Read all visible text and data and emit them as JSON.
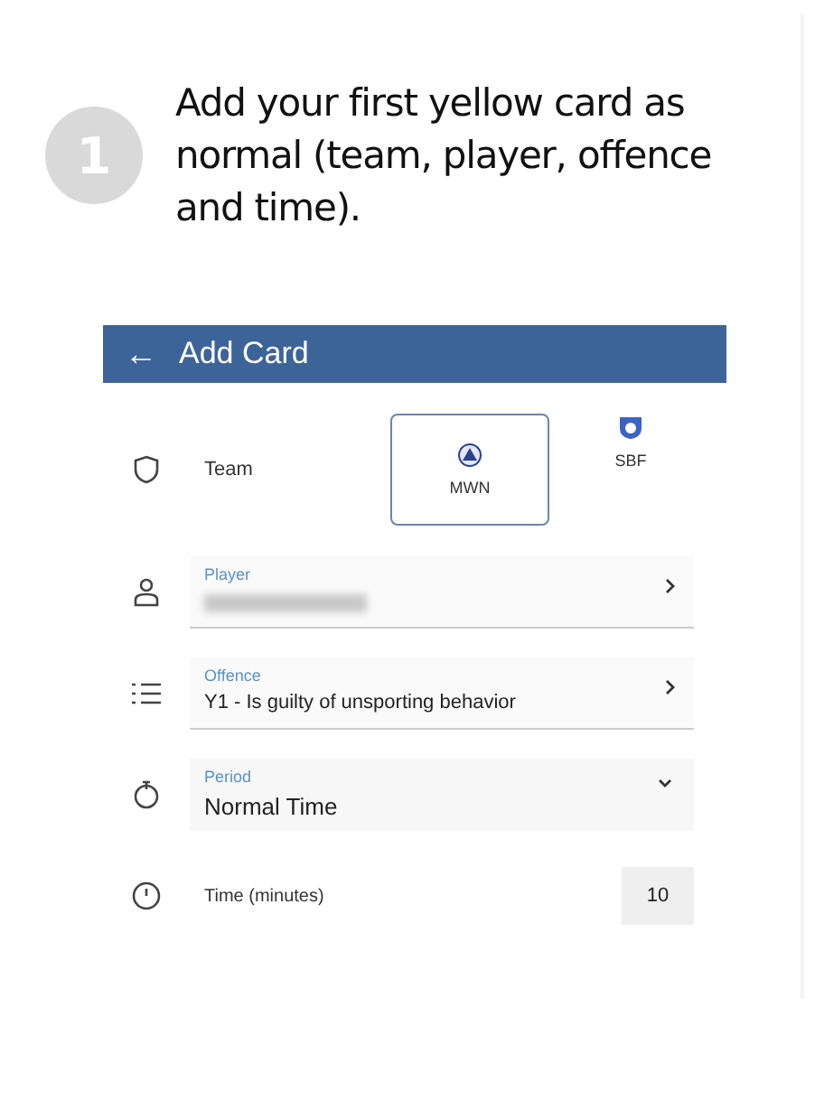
{
  "step": {
    "number": "1",
    "text": "Add your first yellow card as normal (team, player, offence and time)."
  },
  "screen": {
    "title": "Add Card",
    "back_icon": "←",
    "rows": [
      {
        "kind": "team",
        "label": "Team",
        "teams": [
          {
            "name": "MWN",
            "selected": true
          },
          {
            "name": "SBF",
            "selected": false
          }
        ]
      },
      {
        "kind": "picker",
        "label": "Player",
        "value_blurred": true
      },
      {
        "kind": "picker",
        "label": "Offence",
        "value": "Y1 - Is guilty of unsporting behavior"
      },
      {
        "kind": "dropdown",
        "label": "Period",
        "value": "Normal Time"
      },
      {
        "kind": "number",
        "label": "Time (minutes)",
        "value": "10"
      }
    ]
  }
}
